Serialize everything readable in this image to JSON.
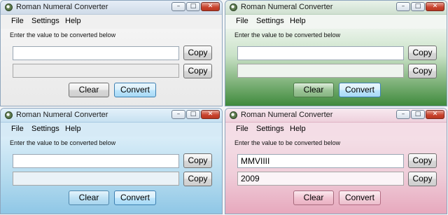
{
  "windows": [
    {
      "title": "Roman Numeral Converter",
      "menu": [
        "File",
        "Settings",
        "Help"
      ],
      "prompt": "Enter the value to be converted below",
      "input_value": "",
      "output_value": "",
      "copy_label": "Copy",
      "clear_label": "Clear",
      "convert_label": "Convert",
      "theme": "#e9e9e9"
    },
    {
      "title": "Roman Numeral Converter",
      "menu": [
        "File",
        "Settings",
        "Help"
      ],
      "prompt": "Enter the value to be converted below",
      "input_value": "",
      "output_value": "",
      "copy_label": "Copy",
      "clear_label": "Clear",
      "convert_label": "Convert",
      "theme": "#3f8a3c"
    },
    {
      "title": "Roman Numeral Converter",
      "menu": [
        "File",
        "Settings",
        "Help"
      ],
      "prompt": "Enter the value to be converted below",
      "input_value": "",
      "output_value": "",
      "copy_label": "Copy",
      "clear_label": "Clear",
      "convert_label": "Convert",
      "theme": "#8fc7e6"
    },
    {
      "title": "Roman Numeral Converter",
      "menu": [
        "File",
        "Settings",
        "Help"
      ],
      "prompt": "Enter the value to be converted below",
      "input_value": "MMVIIII",
      "output_value": "2009",
      "copy_label": "Copy",
      "clear_label": "Clear",
      "convert_label": "Convert",
      "theme": "#e7a8bd"
    }
  ],
  "icons": {
    "app": "converter-app-icon",
    "minimize": "minimize-icon",
    "maximize": "maximize-icon",
    "close": "close-icon"
  }
}
